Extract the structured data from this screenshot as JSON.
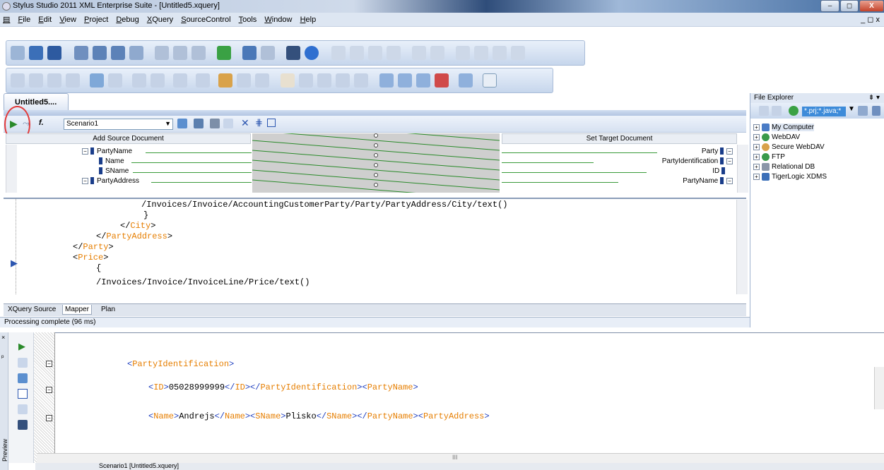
{
  "window": {
    "title": "Stylus Studio 2011 XML Enterprise Suite - [Untitled5.xquery]",
    "min": "–",
    "max": "◻",
    "close": "X"
  },
  "menu": [
    "File",
    "Edit",
    "View",
    "Project",
    "Debug",
    "XQuery",
    "SourceControl",
    "Tools",
    "Window",
    "Help"
  ],
  "mdi_controls": "_ ◻ x",
  "doc_tab": "Untitled5....",
  "mapper": {
    "func_label": "f.",
    "scenario": "Scenario1",
    "source_header": "Add Source Document",
    "target_header": "Set Target Document",
    "source_nodes": [
      "PartyName",
      "Name",
      "SName",
      "PartyAddress"
    ],
    "target_nodes": [
      "Party",
      "PartyIdentification",
      "ID",
      "PartyName"
    ]
  },
  "code_lines": [
    {
      "text": "/Invoices/Invoice/AccountingCustomerParty/Party/PartyAddress/City/text()"
    },
    {
      "text": "}"
    },
    {
      "open": "</",
      "tag": "City",
      "close": ">"
    },
    {
      "open": "</",
      "tag": "PartyAddress",
      "close": ">"
    },
    {
      "open": "</",
      "tag": "Party",
      "close": ">"
    },
    {
      "open": "<",
      "tag": "Price",
      "close": ">"
    },
    {
      "text": "{"
    },
    {
      "text": "/Invoices/Invoice/InvoiceLine/Price/text()"
    },
    {
      "text": "}"
    }
  ],
  "bottom_tabs": [
    "XQuery Source",
    "Mapper",
    "Plan"
  ],
  "status": "Processing complete (96 ms)",
  "file_explorer": {
    "title": "File Explorer",
    "pin": "⇟ ▾",
    "filter": "*.prj;*.java;*",
    "items": [
      "My Computer",
      "WebDAV",
      "Secure WebDAV",
      "FTP",
      "Relational DB",
      "TigerLogic XDMS"
    ]
  },
  "preview": {
    "side_label": "Preview",
    "line1": {
      "tag": "PartyIdentification"
    },
    "line2": {
      "t1": "ID",
      "v1": "05028999999",
      "t2": "ID",
      "t3": "PartyIdentification",
      "t4": "PartyName"
    },
    "line3": {
      "t1": "Name",
      "v1": "Andrejs",
      "t2": "Name",
      "t3": "SName",
      "v2": "Plisko",
      "t4": "SName",
      "t5": "PartyName",
      "t6": "PartyAddress"
    },
    "tab": "Scenario1 [Untitled5.xquery]",
    "scroll_mark": "III"
  },
  "colors": {
    "tag": "#e67e00",
    "bracket": "#1f3fbf",
    "highlight_circle": "#e23a3a"
  }
}
